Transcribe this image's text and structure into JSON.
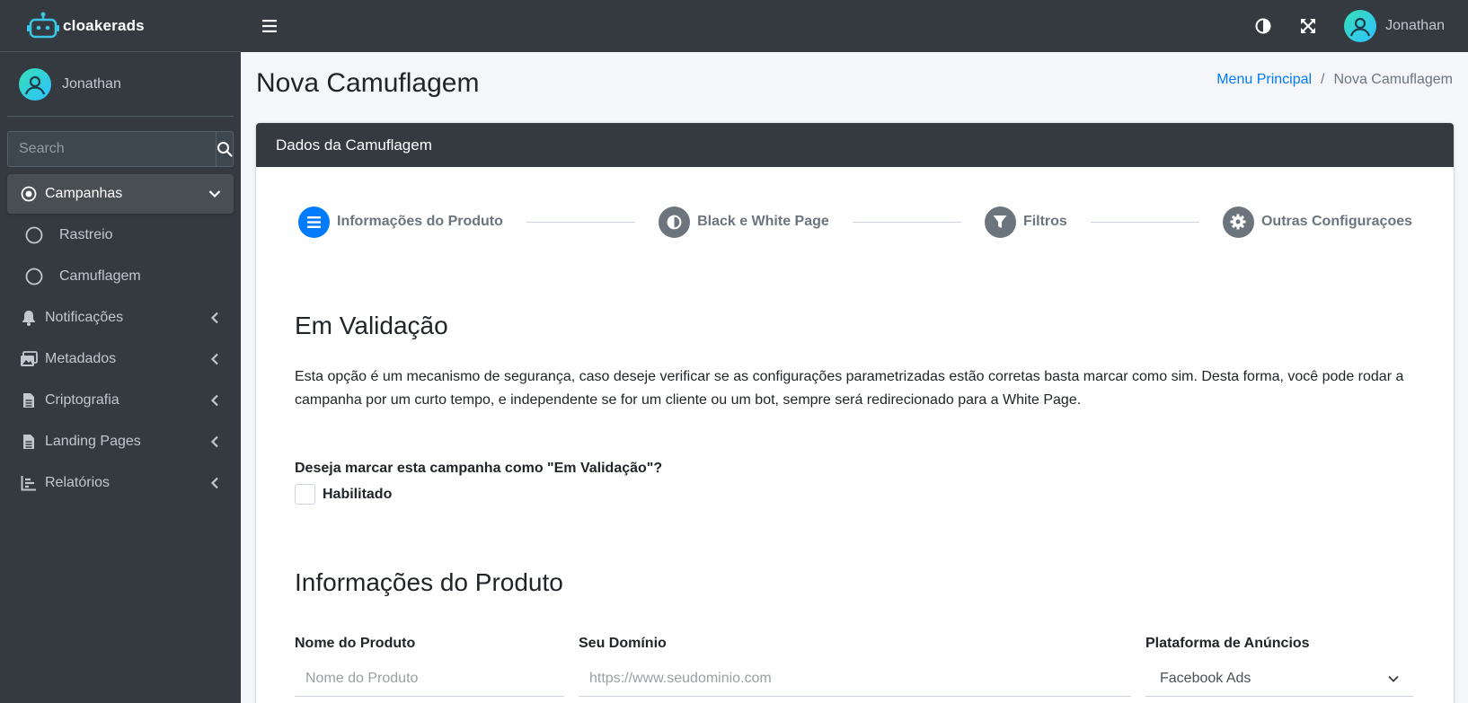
{
  "brand": {
    "name": "cloakerads"
  },
  "user": {
    "name": "Jonathan"
  },
  "search": {
    "placeholder": "Search"
  },
  "sidebar": {
    "items": [
      {
        "label": "Campanhas",
        "icon": "dot-circle-icon"
      },
      {
        "label": "Rastreio",
        "icon": "circle-icon"
      },
      {
        "label": "Camuflagem",
        "icon": "circle-icon"
      },
      {
        "label": "Notificações",
        "icon": "bell-icon"
      },
      {
        "label": "Metadados",
        "icon": "images-icon"
      },
      {
        "label": "Criptografia",
        "icon": "file-icon"
      },
      {
        "label": "Landing Pages",
        "icon": "file-icon"
      },
      {
        "label": "Relatórios",
        "icon": "chart-icon"
      }
    ]
  },
  "page": {
    "title": "Nova Camuflagem"
  },
  "breadcrumb": {
    "home": "Menu Principal",
    "separator": "/",
    "current": "Nova Camuflagem"
  },
  "card": {
    "title": "Dados da Camuflagem"
  },
  "steps": [
    {
      "label": "Informações do Produto",
      "icon": "list-icon"
    },
    {
      "label": "Black e White Page",
      "icon": "half-circle-icon"
    },
    {
      "label": "Filtros",
      "icon": "filter-icon"
    },
    {
      "label": "Outras Configuraçoes",
      "icon": "gear-icon"
    }
  ],
  "validation": {
    "title": "Em Validação",
    "description": "Esta opção é um mecanismo de segurança, caso deseje verificar se as configurações parametrizadas estão corretas basta marcar como sim. Desta forma, você pode rodar a campanha por um curto tempo, e independente se for um cliente ou um bot, sempre será redirecionado para a White Page.",
    "question": "Deseja marcar esta campanha como \"Em Validação\"?",
    "checkbox_label": "Habilitado"
  },
  "product": {
    "title": "Informações do Produto",
    "name_label": "Nome do Produto",
    "name_placeholder": "Nome do Produto",
    "domain_label": "Seu Domínio",
    "domain_placeholder": "https://www.seudominio.com",
    "platform_label": "Plataforma de Anúncios",
    "platform_value": "Facebook Ads"
  },
  "colors": {
    "primary": "#007bff",
    "sidebar_bg": "#343a40",
    "step_inactive": "#6c757d"
  }
}
